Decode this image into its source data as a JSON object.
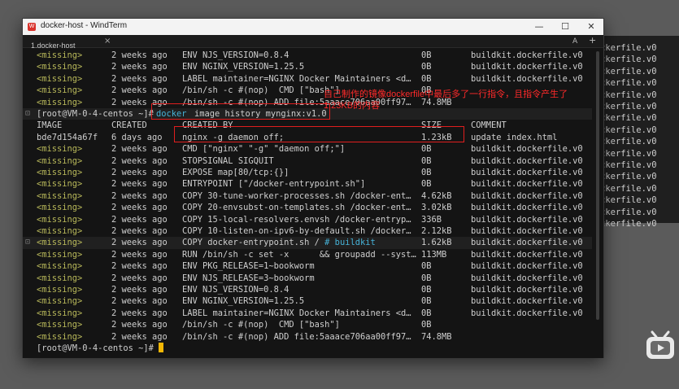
{
  "window": {
    "title": "docker-host - WindTerm",
    "controls": {
      "minimize": "—",
      "maximize": "☐",
      "close": "✕"
    }
  },
  "tabs": [
    {
      "label": "1.docker-host",
      "close": "×"
    }
  ],
  "tabbar": {
    "menu": "A",
    "add": "+"
  },
  "background_terminal": {
    "lines": [
      "ckerfile.v0",
      "ckerfile.v0",
      "ckerfile.v0",
      "ckerfile.v0",
      "ckerfile.v0",
      "ckerfile.v0",
      "ckerfile.v0",
      "ckerfile.v0",
      "ckerfile.v0",
      "ckerfile.v0",
      "ckerfile.v0",
      "ckerfile.v0",
      "ckerfile.v0",
      "ckerfile.v0",
      "ckerfile.v0",
      "ckerfile.v0"
    ]
  },
  "terminal": {
    "lines": [
      {
        "kind": "row",
        "image": "<missing>",
        "created": "2 weeks ago",
        "created_by": "ENV NJS_VERSION=0.8.4",
        "size": "0B",
        "comment": "buildkit.dockerfile.v0"
      },
      {
        "kind": "row",
        "image": "<missing>",
        "created": "2 weeks ago",
        "created_by": "ENV NGINX_VERSION=1.25.5",
        "size": "0B",
        "comment": "buildkit.dockerfile.v0"
      },
      {
        "kind": "row",
        "image": "<missing>",
        "created": "2 weeks ago",
        "created_by": "LABEL maintainer=NGINX Docker Maintainers <d…",
        "size": "0B",
        "comment": "buildkit.dockerfile.v0"
      },
      {
        "kind": "row",
        "image": "<missing>",
        "created": "2 weeks ago",
        "created_by": "/bin/sh -c #(nop)  CMD [\"bash\"]",
        "size": "0B",
        "comment": ""
      },
      {
        "kind": "row",
        "image": "<missing>",
        "created": "2 weeks ago",
        "created_by": "/bin/sh -c #(nop) ADD file:5aaace706aa00ff97…",
        "size": "74.8MB",
        "comment": ""
      },
      {
        "kind": "cmd",
        "prompt": "[root@VM-0-4-centos ~]#",
        "command": "docker",
        "args": "image history mynginx:v1.0"
      },
      {
        "kind": "header",
        "image": "IMAGE",
        "created": "CREATED",
        "created_by": "CREATED BY",
        "size": "SIZE",
        "comment": "COMMENT"
      },
      {
        "kind": "row",
        "image": "bde7d154a67f",
        "created": "6 days ago",
        "created_by": "nginx -g daemon off;",
        "size": "1.23kB",
        "comment": "update index.html"
      },
      {
        "kind": "row",
        "image": "<missing>",
        "created": "2 weeks ago",
        "created_by": "CMD [\"nginx\" \"-g\" \"daemon off;\"]",
        "size": "0B",
        "comment": "buildkit.dockerfile.v0"
      },
      {
        "kind": "row",
        "image": "<missing>",
        "created": "2 weeks ago",
        "created_by": "STOPSIGNAL SIGQUIT",
        "size": "0B",
        "comment": "buildkit.dockerfile.v0"
      },
      {
        "kind": "row",
        "image": "<missing>",
        "created": "2 weeks ago",
        "created_by": "EXPOSE map[80/tcp:{}]",
        "size": "0B",
        "comment": "buildkit.dockerfile.v0"
      },
      {
        "kind": "row",
        "image": "<missing>",
        "created": "2 weeks ago",
        "created_by": "ENTRYPOINT [\"/docker-entrypoint.sh\"]",
        "size": "0B",
        "comment": "buildkit.dockerfile.v0"
      },
      {
        "kind": "row",
        "image": "<missing>",
        "created": "2 weeks ago",
        "created_by": "COPY 30-tune-worker-processes.sh /docker-ent…",
        "size": "4.62kB",
        "comment": "buildkit.dockerfile.v0"
      },
      {
        "kind": "row",
        "image": "<missing>",
        "created": "2 weeks ago",
        "created_by": "COPY 20-envsubst-on-templates.sh /docker-ent…",
        "size": "3.02kB",
        "comment": "buildkit.dockerfile.v0"
      },
      {
        "kind": "row",
        "image": "<missing>",
        "created": "2 weeks ago",
        "created_by": "COPY 15-local-resolvers.envsh /docker-entryp…",
        "size": "336B",
        "comment": "buildkit.dockerfile.v0"
      },
      {
        "kind": "row",
        "image": "<missing>",
        "created": "2 weeks ago",
        "created_by": "COPY 10-listen-on-ipv6-by-default.sh /docker…",
        "size": "2.12kB",
        "comment": "buildkit.dockerfile.v0"
      },
      {
        "kind": "row",
        "image": "<missing>",
        "created": "2 weeks ago",
        "created_by": "COPY docker-entrypoint.sh / # buildkit",
        "size": "1.62kB",
        "comment": "buildkit.dockerfile.v0"
      },
      {
        "kind": "row",
        "image": "<missing>",
        "created": "2 weeks ago",
        "created_by": "RUN /bin/sh -c set -x      && groupadd --syst…",
        "size": "113MB",
        "comment": "buildkit.dockerfile.v0"
      },
      {
        "kind": "row",
        "image": "<missing>",
        "created": "2 weeks ago",
        "created_by": "ENV PKG_RELEASE=1~bookworm",
        "size": "0B",
        "comment": "buildkit.dockerfile.v0"
      },
      {
        "kind": "row",
        "image": "<missing>",
        "created": "2 weeks ago",
        "created_by": "ENV NJS_RELEASE=3~bookworm",
        "size": "0B",
        "comment": "buildkit.dockerfile.v0"
      },
      {
        "kind": "row",
        "image": "<missing>",
        "created": "2 weeks ago",
        "created_by": "ENV NJS_VERSION=0.8.4",
        "size": "0B",
        "comment": "buildkit.dockerfile.v0"
      },
      {
        "kind": "row",
        "image": "<missing>",
        "created": "2 weeks ago",
        "created_by": "ENV NGINX_VERSION=1.25.5",
        "size": "0B",
        "comment": "buildkit.dockerfile.v0"
      },
      {
        "kind": "row",
        "image": "<missing>",
        "created": "2 weeks ago",
        "created_by": "LABEL maintainer=NGINX Docker Maintainers <d…",
        "size": "0B",
        "comment": "buildkit.dockerfile.v0"
      },
      {
        "kind": "row",
        "image": "<missing>",
        "created": "2 weeks ago",
        "created_by": "/bin/sh -c #(nop)  CMD [\"bash\"]",
        "size": "0B",
        "comment": ""
      },
      {
        "kind": "row",
        "image": "<missing>",
        "created": "2 weeks ago",
        "created_by": "/bin/sh -c #(nop) ADD file:5aaace706aa00ff97…",
        "size": "74.8MB",
        "comment": ""
      }
    ],
    "prompt": "[root@VM-0-4-centos ~]#"
  },
  "annotation": "自己制作的镜像dockerfile中最后多了一行指令，且指令产生了1.23KB的内容",
  "colors": {
    "annotation": "#e01e1e",
    "cursor": "#f2b705",
    "keyword": "#46b3d8",
    "number": "#cfcf4a",
    "missing": "#b9b95a"
  }
}
